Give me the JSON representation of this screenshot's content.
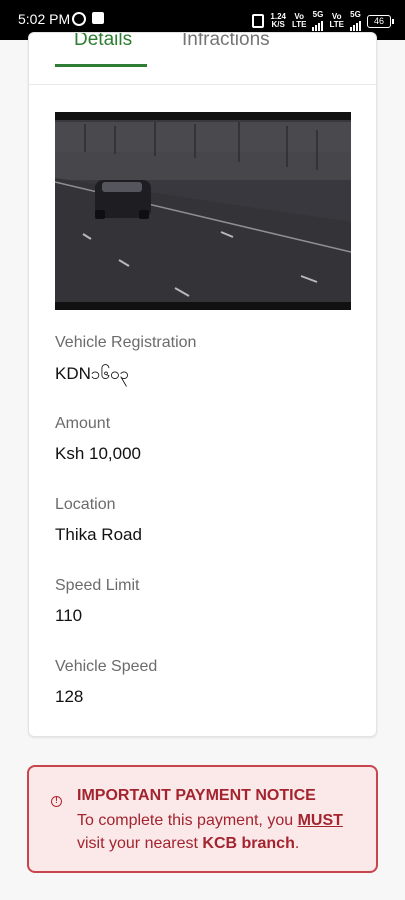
{
  "status_bar": {
    "time": "5:02 PM",
    "net_speed_value": "1.24",
    "net_speed_unit": "K/S",
    "sim1_line1": "Vo",
    "sim1_line2": "LTE",
    "sim1_net": "5G",
    "sim2_line1": "Vo",
    "sim2_line2": "LTE",
    "sim2_net": "5G",
    "battery": "46"
  },
  "tabs": [
    {
      "label": "Details",
      "active": true
    },
    {
      "label": "Infractions",
      "active": false
    }
  ],
  "details": {
    "registration_label": "Vehicle Registration",
    "registration_value": "KDN၁၆၀၃",
    "amount_label": "Amount",
    "amount_value": "Ksh 10,000",
    "location_label": "Location",
    "location_value": "Thika Road",
    "speed_limit_label": "Speed Limit",
    "speed_limit_value": "110",
    "vehicle_speed_label": "Vehicle Speed",
    "vehicle_speed_value": "128"
  },
  "notice": {
    "title": "IMPORTANT PAYMENT NOTICE",
    "body_prefix": "To complete this payment, you ",
    "must": "MUST",
    "body_middle": " visit your nearest ",
    "branch": "KCB branch",
    "body_suffix": "."
  },
  "colors": {
    "accent_green": "#2e7d32",
    "notice_red": "#a3242f",
    "notice_bg": "#fbe9e9"
  }
}
